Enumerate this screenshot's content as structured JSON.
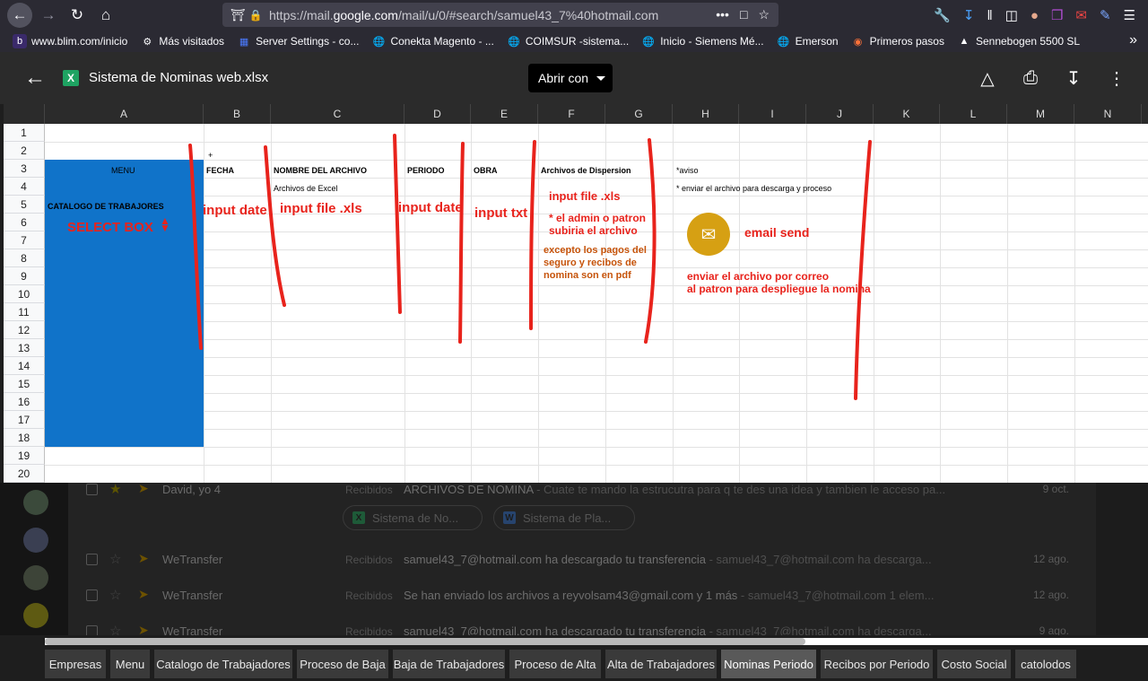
{
  "browser": {
    "url_prefix": "https://mail.",
    "url_domain": "google.com",
    "url_rest": "/mail/u/0/#search/samuel43_7%40hotmail.com",
    "more_label": "•••"
  },
  "bookmarks": [
    {
      "label": "www.blim.com/inicio",
      "icon": "blim-icon"
    },
    {
      "label": "Más visitados",
      "icon": "gear-icon"
    },
    {
      "label": "Server Settings - co...",
      "icon": "grid-icon"
    },
    {
      "label": "Conekta Magento - ...",
      "icon": "globe-icon"
    },
    {
      "label": "COIMSUR -sistema...",
      "icon": "globe-icon"
    },
    {
      "label": "Inicio - Siemens Mé...",
      "icon": "globe-icon"
    },
    {
      "label": "Emerson",
      "icon": "globe-icon"
    },
    {
      "label": "Primeros pasos",
      "icon": "firefox-icon"
    },
    {
      "label": "Sennebogen 5500 SL",
      "icon": "elephant-icon"
    }
  ],
  "viewer": {
    "file_title": "Sistema de Nominas web.xlsx",
    "open_with_label": "Abrir con",
    "xls_badge": "X"
  },
  "sheet": {
    "columns": [
      "A",
      "B",
      "C",
      "D",
      "E",
      "F",
      "G",
      "H",
      "I",
      "J",
      "K",
      "L",
      "M",
      "N"
    ],
    "rows": [
      "1",
      "2",
      "3",
      "4",
      "5",
      "6",
      "7",
      "8",
      "9",
      "10",
      "11",
      "12",
      "13",
      "14",
      "15",
      "16",
      "17",
      "18",
      "19",
      "20"
    ],
    "cells": {
      "plus": "+",
      "menu": "MENU",
      "fecha": "FECHA",
      "nombre_archivo": "NOMBRE DEL ARCHIVO",
      "periodo": "PERIODO",
      "obra": "OBRA",
      "archivos_dispersion": "Archivos de Dispersion",
      "aviso": "*aviso",
      "archivos_excel": "Archivos de Excel",
      "enviar_archivo": "* enviar el archivo para descarga y proceso",
      "catalogo": "CATALOGO DE TRABAJORES"
    },
    "annotations": {
      "select_box": "SELECT BOX",
      "input_date_1": "input date",
      "input_file_xls_1": "input  file  .xls",
      "input_date_2": "input date",
      "input_txt": "input txt",
      "input_file_xls_2": "input  file .xls",
      "admin_note_1": "* el admin o patron",
      "admin_note_2": "subiria el archivo",
      "except_1": "excepto los pagos del",
      "except_2": "seguro y recibos de",
      "except_3": "nomina son en pdf",
      "email_send": "email send",
      "enviar_correo_1": "enviar el archivo por correo",
      "enviar_correo_2": "al patron para despliegue la nomina"
    },
    "colors": {
      "menu_block": "#1073c9",
      "annotation_red": "#e8231c",
      "annotation_orange": "#c6530a",
      "email_icon": "#d6a013"
    }
  },
  "gmail_bg": {
    "rows": [
      {
        "sender": "David, yo 4",
        "label": "Recibidos",
        "subject": "ARCHIVOS DE NOMINA",
        "snippet": " - Cuate te mando la estrucutra para q te des una idea y tambien le acceso pa...",
        "date": "9 oct."
      },
      {
        "sender": "WeTransfer",
        "label": "Recibidos",
        "subject": "samuel43_7@hotmail.com ha descargado tu transferencia",
        "snippet": " - samuel43_7@hotmail.com ha descarga...",
        "date": "12 ago."
      },
      {
        "sender": "WeTransfer",
        "label": "Recibidos",
        "subject": "Se han enviado los archivos a reyvolsam43@gmail.com y 1 más",
        "snippet": " - samuel43_7@hotmail.com 1 elem...",
        "date": "12 ago."
      },
      {
        "sender": "WeTransfer",
        "label": "Recibidos",
        "subject": "samuel43_7@hotmail.com ha descargado tu transferencia",
        "snippet": " - samuel43_7@hotmail.com ha descarga...",
        "date": "9 ago."
      }
    ],
    "attachments": [
      "Sistema de No...",
      "Sistema de Pla..."
    ]
  },
  "sheet_tabs": [
    {
      "label": "Empresas",
      "active": false
    },
    {
      "label": "Menu",
      "active": false
    },
    {
      "label": "Catalogo de Trabajadores",
      "active": false
    },
    {
      "label": "Proceso de Baja",
      "active": false
    },
    {
      "label": "Baja de Trabajadores",
      "active": false
    },
    {
      "label": "Proceso de Alta",
      "active": false
    },
    {
      "label": "Alta de Trabajadores",
      "active": false
    },
    {
      "label": "Nominas Periodo",
      "active": true
    },
    {
      "label": "Recibos por Periodo",
      "active": false
    },
    {
      "label": "Costo Social",
      "active": false
    },
    {
      "label": "catolodos",
      "active": false
    }
  ]
}
